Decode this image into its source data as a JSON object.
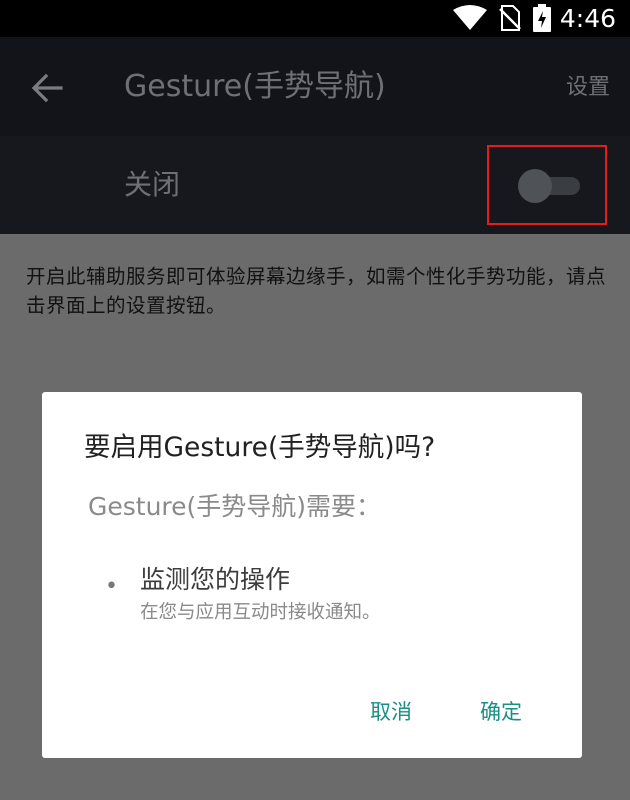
{
  "status_bar": {
    "time": "4:46",
    "icons": [
      "wifi-icon",
      "no-sim-icon",
      "battery-charging-icon"
    ]
  },
  "toolbar": {
    "back_icon": "arrow-left-icon",
    "title": "Gesture(手势导航)",
    "settings_label": "设置"
  },
  "switch_row": {
    "label": "关闭",
    "state": "off"
  },
  "description": "开启此辅助服务即可体验屏幕边缘手，如需个性化手势功能，请点击界面上的设置按钮。",
  "dialog": {
    "title": "要启用Gesture(手势导航)吗?",
    "subtitle": "Gesture(手势导航)需要：",
    "permission_bullet": "•",
    "permission_title": "监测您的操作",
    "permission_desc": "在您与应用互动时接收通知。",
    "cancel_label": "取消",
    "ok_label": "确定"
  },
  "colors": {
    "accent": "#1a8f86",
    "highlight_box": "#e41c1c",
    "toolbar_bg": "#121419",
    "scrim_bg": "#6b6b6b"
  }
}
